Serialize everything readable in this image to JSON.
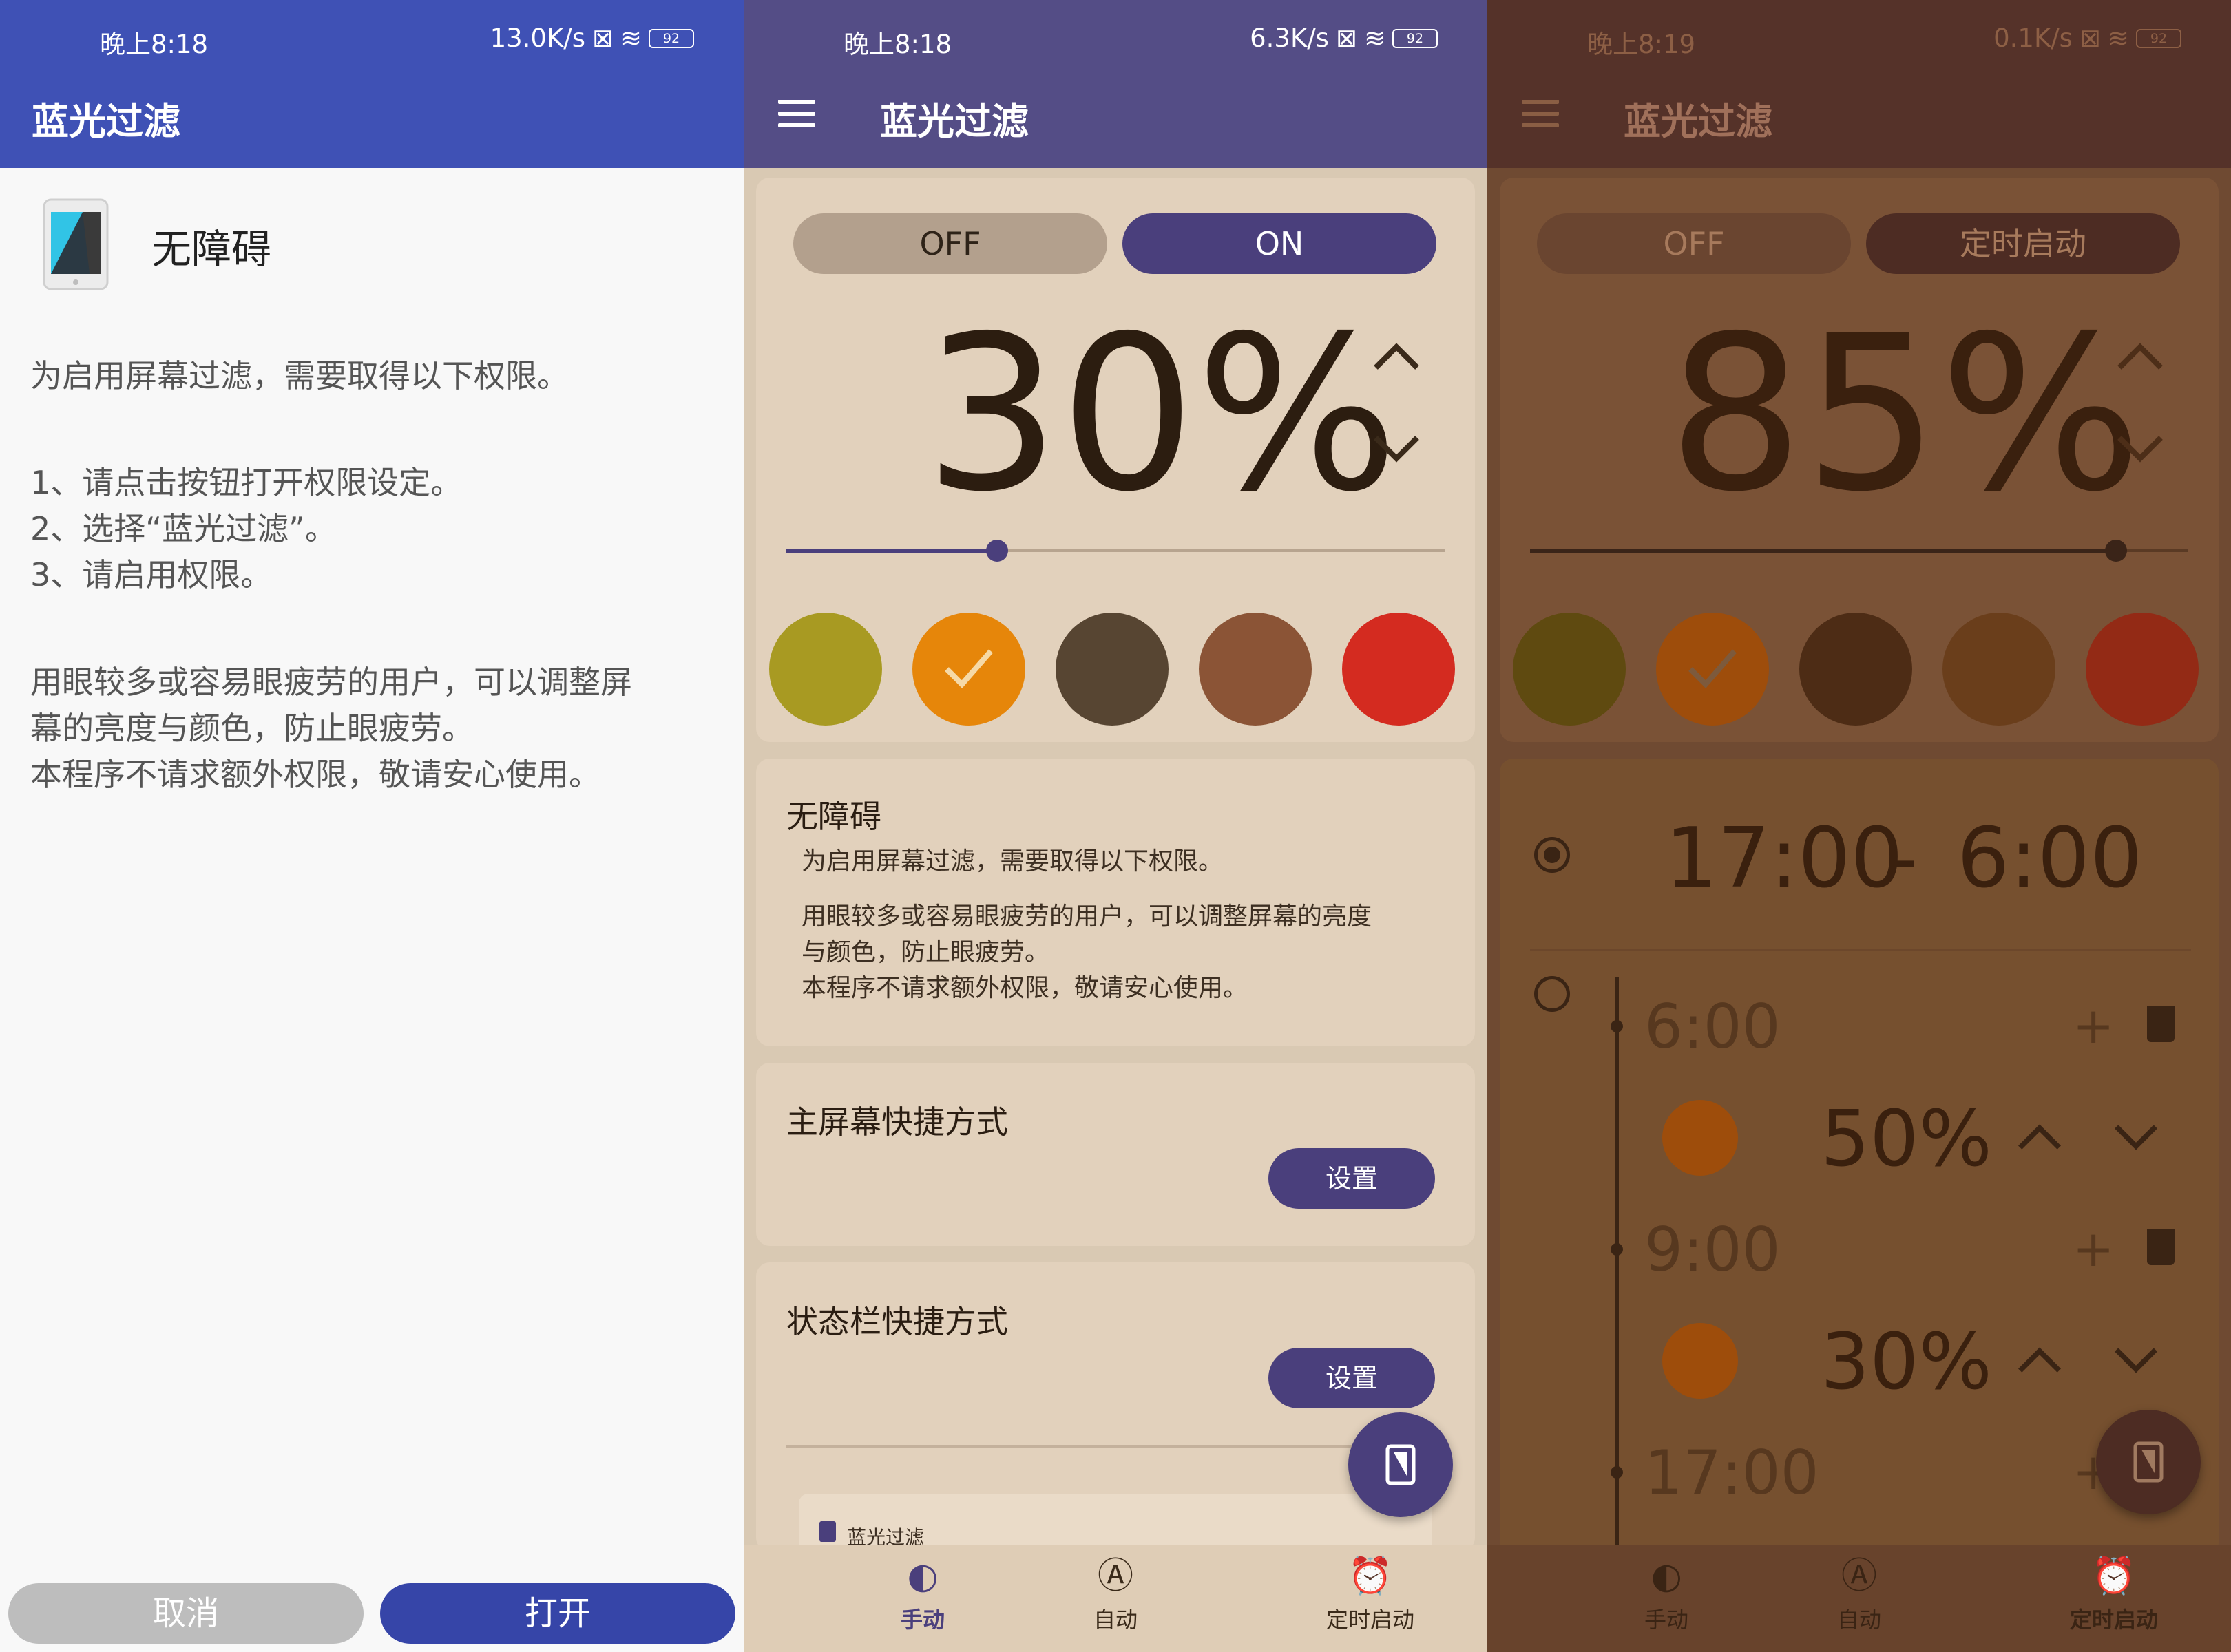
{
  "screen1": {
    "status": {
      "time": "晚上8:18",
      "speed": "13.0K/s",
      "battery": "92"
    },
    "title": "蓝光过滤",
    "accessibility_label": "无障碍",
    "intro": "为启用屏幕过滤，需要取得以下权限。",
    "steps": [
      "1、请点击按钮打开权限设定。",
      "2、选择“蓝光过滤”。",
      "3、请启用权限。"
    ],
    "desc_lines": [
      "用眼较多或容易眼疲劳的用户，可以调整屏",
      "幕的亮度与颜色，防止眼疲劳。",
      "本程序不请求额外权限，敬请安心使用。"
    ],
    "cancel_label": "取消",
    "open_label": "打开",
    "colors": {
      "appbar": "#3f51b5",
      "open": "#3645a8",
      "cancel": "#bdbdbd"
    }
  },
  "screen2": {
    "status": {
      "time": "晚上8:18",
      "speed": "6.3K/s",
      "battery": "92"
    },
    "title": "蓝光过滤",
    "off_label": "OFF",
    "on_label": "ON",
    "percent": "30%",
    "slider_value": 0.32,
    "accessibility_title": "无障碍",
    "accessibility_intro": "为启用屏幕过滤，需要取得以下权限。",
    "accessibility_desc": [
      "用眼较多或容易眼疲劳的用户，可以调整屏幕的亮度",
      "与颜色，防止眼疲劳。",
      "本程序不请求额外权限，敬请安心使用。"
    ],
    "home_shortcut_title": "主屏幕快捷方式",
    "statusbar_shortcut_title": "状态栏快捷方式",
    "set_label": "设置",
    "notif_preview": "蓝光过滤",
    "nav": [
      "手动",
      "自动",
      "定时启动"
    ],
    "swatches": [
      "#a89a22",
      "#e6860a",
      "#574532",
      "#8b5436",
      "#d42b20"
    ],
    "colors": {
      "appbar": "#544d86",
      "accent": "#4a3f7c"
    }
  },
  "screen3": {
    "status": {
      "time": "晚上8:19",
      "speed": "0.1K/s",
      "battery": "92"
    },
    "title": "蓝光过滤",
    "off_label": "OFF",
    "timer_label": "定时启动",
    "percent": "85%",
    "slider_value": 0.89,
    "range_start": "17:00",
    "range_sep": "-",
    "range_end": "6:00",
    "schedule": [
      {
        "time": "6:00",
        "percent": "50%"
      },
      {
        "time": "9:00",
        "percent": "30%"
      },
      {
        "time": "17:00"
      }
    ],
    "nav": [
      "手动",
      "自动",
      "定时启动"
    ],
    "swatches": [
      "#5f4a10",
      "#9e4d0b",
      "#4d2c15",
      "#6a3e1b",
      "#932a15"
    ],
    "colors": {
      "appbar": "#553229",
      "bg": "#6f4a32"
    }
  }
}
